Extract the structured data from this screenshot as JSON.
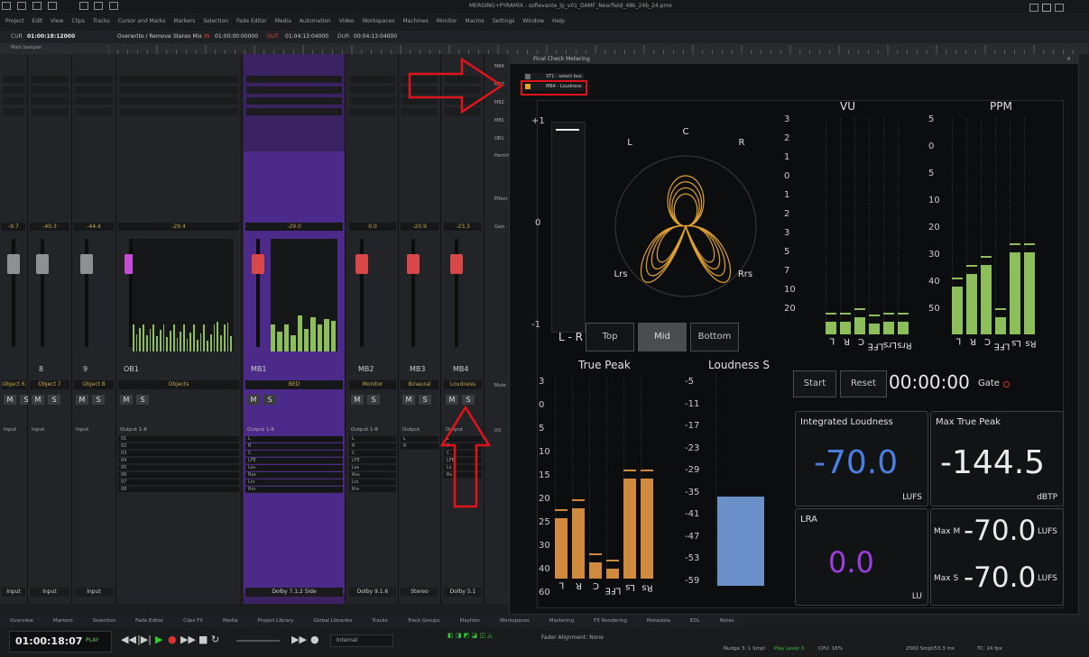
{
  "window": {
    "title": "MERGING+PYRAMIX - sofievante_lp_v01_DAMF_Nearfield_48k_24b_24.pmx"
  },
  "menu": [
    "Project",
    "Edit",
    "View",
    "Clips",
    "Tracks",
    "Cursor and Marks",
    "Markers",
    "Selection",
    "Fade Editor",
    "Media",
    "Automation",
    "Video",
    "Workspaces",
    "Machines",
    "Monitor",
    "Macros",
    "Settings",
    "Window",
    "Help"
  ],
  "transport_bar": {
    "cur_label": "CUR",
    "cur_time": "01:00:18:12000",
    "mode": "Overwrite / Remove",
    "stereo": "Stereo Mix",
    "in_label": "IN",
    "in_time": "01:00:00:00000",
    "out_label": "OUT",
    "out_time": "01:04:13:04000",
    "dur_label": "DUR",
    "dur_time": "00:04:13:04000"
  },
  "ruler": {
    "label": "Main Sampler"
  },
  "mixer": {
    "strips": [
      {
        "number": "",
        "name": "Object 6",
        "value": "-9.7",
        "out": "Input",
        "bus": "Input",
        "color": "#8e9094"
      },
      {
        "number": "8",
        "name": "Object 7",
        "value": "-40.3",
        "out": "Input",
        "bus": "Input",
        "color": "#8e9094"
      },
      {
        "number": "9",
        "name": "Object 8",
        "value": "-44.4",
        "out": "Input",
        "bus": "Input",
        "color": "#8e9094"
      },
      {
        "number": "OB1",
        "name": "Objects",
        "value": "-29.4",
        "out": "Output 1-8",
        "bus": "",
        "color": "#c64dd6"
      },
      {
        "number": "MB1",
        "name": "BED",
        "value": "-29.0",
        "out": "Output 1-8",
        "bus": "Dolby 7.1.2 Side",
        "color": "#d84848"
      },
      {
        "number": "MB2",
        "name": "Monitor",
        "value": "0.0",
        "out": "Output 1-8",
        "bus": "Dolby 9.1.6",
        "color": "#d84848"
      },
      {
        "number": "MB3",
        "name": "Binaural",
        "value": "-20.9",
        "out": "Output",
        "bus": "Stereo",
        "color": "#d84848"
      },
      {
        "number": "MB4",
        "name": "Loudness",
        "value": "-23.3",
        "out": "Output",
        "bus": "Dolby 5.1",
        "color": "#d84848"
      }
    ],
    "channel_slots": [
      "01",
      "02",
      "03",
      "04",
      "05",
      "06",
      "07",
      "08"
    ],
    "bed_slots": [
      "L",
      "R",
      "C",
      "LFE",
      "Lss",
      "Rss",
      "Lrs",
      "Rrs"
    ],
    "loudness_slots": [
      "L",
      "R",
      "C",
      "LFE",
      "Ls",
      "Rs"
    ],
    "side_labels": [
      "MB4",
      "MB3",
      "MB2",
      "MB1",
      "OB1",
      "Panning",
      "Effect",
      "Gain",
      "Mute",
      "I/O"
    ],
    "emphasis_color": "#e0141a"
  },
  "meter_window": {
    "title": "Final Check Metering",
    "bus_list": [
      {
        "label": "ST1 - select bus",
        "color": "#6a6c70"
      },
      {
        "label": "MB4 - Loudness",
        "color": "#e0a030"
      }
    ],
    "lr_meter": {
      "label": "L - R",
      "ticks": [
        "+1",
        "0",
        "-1"
      ],
      "level": 0.97
    },
    "surround": {
      "speakers": [
        "L",
        "C",
        "R",
        "Lrs",
        "Rrs"
      ],
      "views": [
        "Top",
        "Mid",
        "Bottom"
      ],
      "active_view": "Mid"
    },
    "vu": {
      "title": "VU",
      "ticks": [
        "3",
        "2",
        "1",
        "0",
        "1",
        "2",
        "3",
        "5",
        "7",
        "10",
        "20"
      ],
      "channels": [
        "L",
        "R",
        "C",
        "LFE",
        "Lrs",
        "Rrs"
      ],
      "levels": [
        0.06,
        0.06,
        0.08,
        0.05,
        0.06,
        0.06
      ]
    },
    "ppm": {
      "title": "PPM",
      "ticks": [
        "5",
        "0",
        "5",
        "10",
        "20",
        "30",
        "40",
        "50"
      ],
      "channels": [
        "L",
        "R",
        "C",
        "LFE",
        "Ls",
        "Rs"
      ],
      "levels": [
        0.22,
        0.28,
        0.32,
        0.08,
        0.38,
        0.38
      ]
    },
    "true_peak": {
      "title": "True Peak",
      "ticks": [
        "3",
        "0",
        "5",
        "10",
        "15",
        "20",
        "25",
        "30",
        "40",
        "60"
      ],
      "channels": [
        "L",
        "R",
        "C",
        "LFE",
        "Ls",
        "Rs"
      ],
      "levels": [
        0.3,
        0.35,
        0.08,
        0.05,
        0.5,
        0.5
      ]
    },
    "loudness_s": {
      "title": "Loudness S",
      "ticks": [
        "-5",
        "-11",
        "-17",
        "-23",
        "-29",
        "-35",
        "-41",
        "-47",
        "-53",
        "-59"
      ],
      "level": 0.42
    },
    "controls": {
      "start": "Start",
      "reset": "Reset",
      "timer": "00:00:00",
      "gate": "Gate"
    },
    "integrated_loudness": {
      "label": "Integrated Loudness",
      "value": "-70.0",
      "unit": "LUFS"
    },
    "max_true_peak": {
      "label": "Max True Peak",
      "value": "-144.5",
      "unit": "dBTP"
    },
    "lra": {
      "label": "LRA",
      "value": "0.0",
      "unit": "LU"
    },
    "max_m": {
      "label": "Max M",
      "value": "-70.0",
      "unit": "LUFS"
    },
    "max_s": {
      "label": "Max S",
      "value": "-70.0",
      "unit": "LUFS"
    },
    "colors": {
      "vu_bar": "#8cbf5a",
      "tp_bar": "#d08a3e",
      "ls_bar": "#6b8fc9",
      "integrated": "#4a7fe0",
      "lra": "#9b3fe0",
      "rose": "#e0a030"
    }
  },
  "bottom_tabs": [
    "Overview",
    "Markers",
    "Selection",
    "Fade Editor",
    "Clips FX",
    "Media",
    "Project Library",
    "Global Libraries",
    "Tracks",
    "Track Groups",
    "Playlists",
    "Workspaces",
    "Mastering",
    "FX Rendering",
    "Metadata",
    "EDL",
    "Notes"
  ],
  "transport": {
    "time": "01:00:18:07",
    "state": "PLAY",
    "clock": "Internal",
    "fader_alignment": "Fader Alignment: None"
  },
  "status": {
    "nudge": "Nudge 3: 1 Smpl",
    "play_level": "Play Level 3",
    "cpu": "CPU: 16%",
    "buffer": "2560 Smpl/53.3 ms",
    "tc": "TC: 24 fps"
  }
}
